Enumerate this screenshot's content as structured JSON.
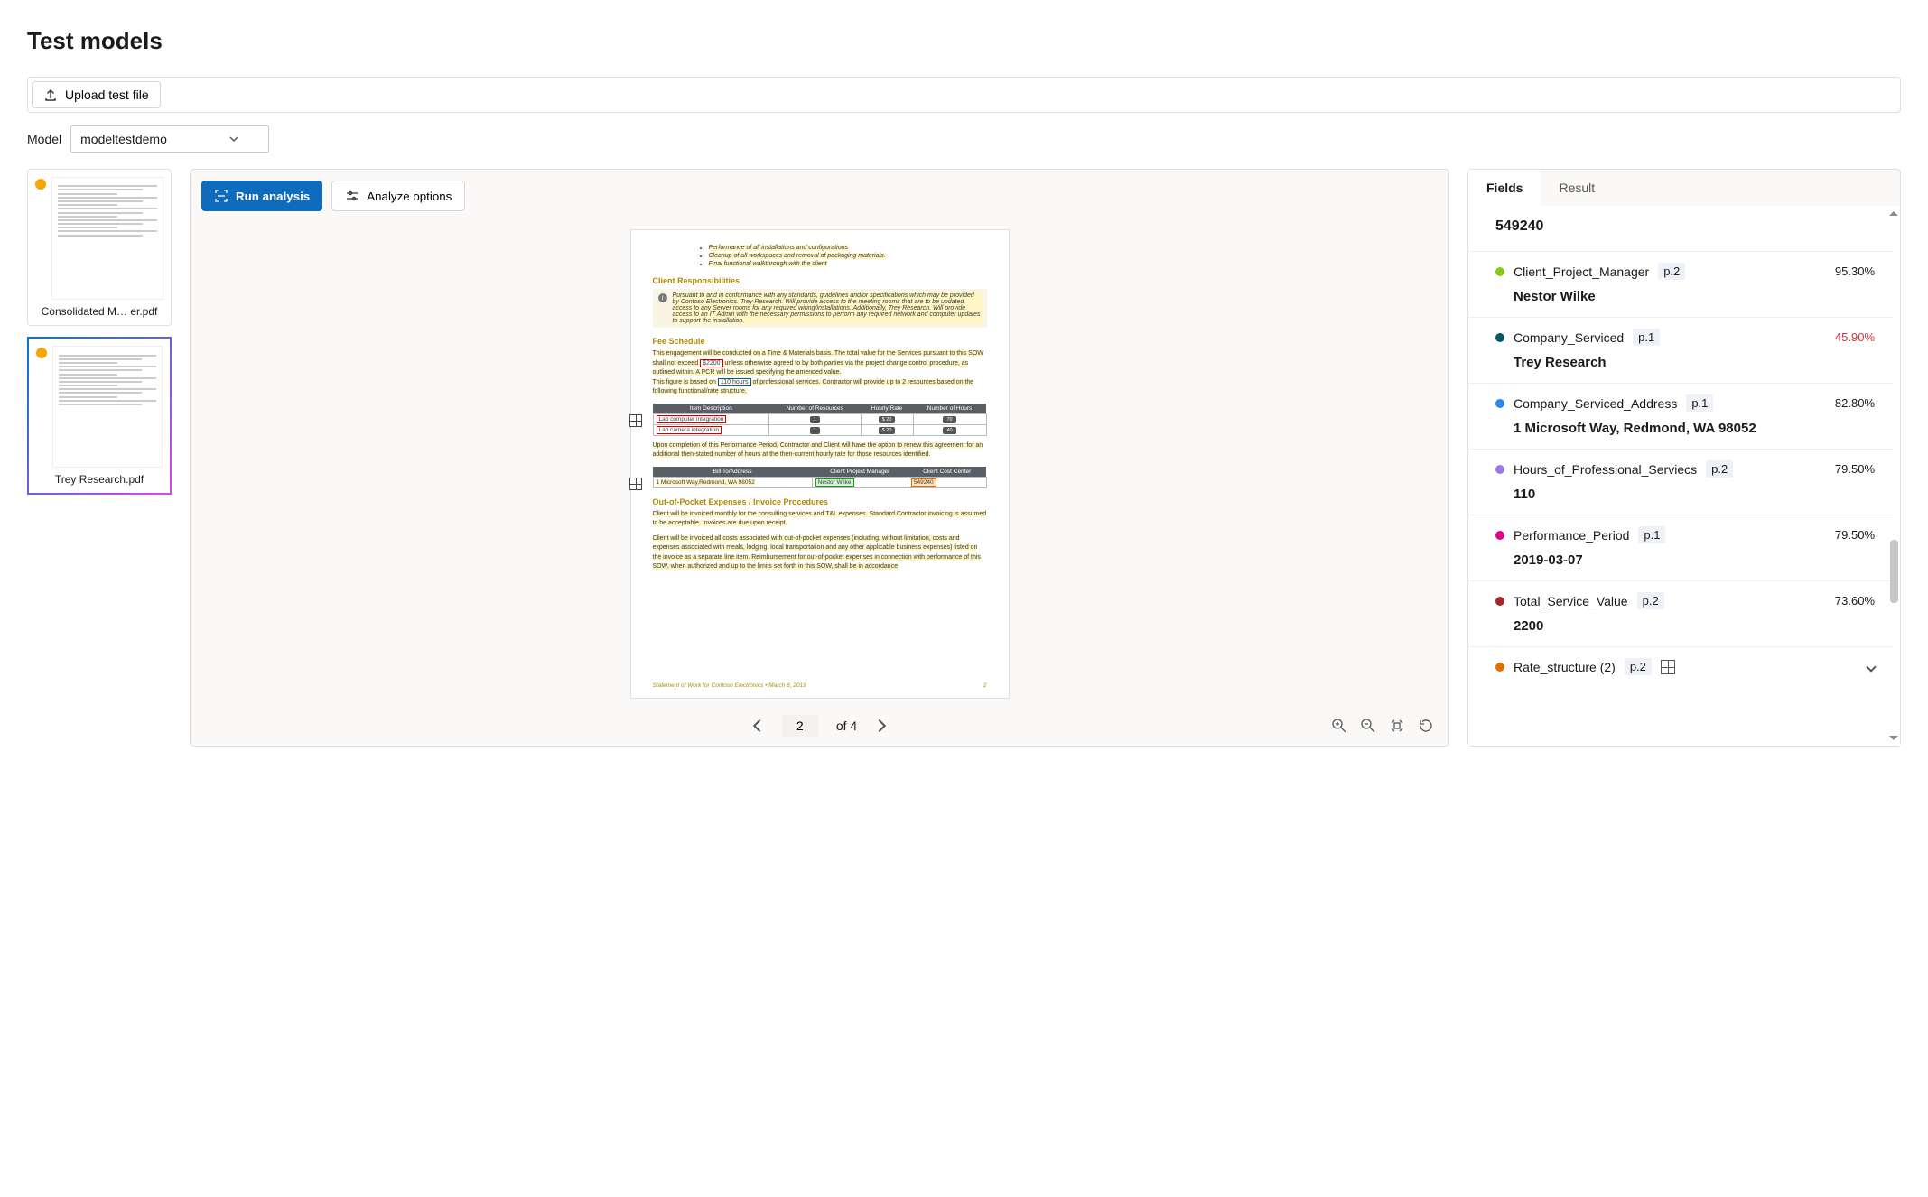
{
  "header": {
    "title": "Test models"
  },
  "toolbar": {
    "upload_label": "Upload test file"
  },
  "modelRow": {
    "label": "Model",
    "selected": "modeltestdemo"
  },
  "thumbs": [
    {
      "name": "Consolidated M… er.pdf",
      "selected": false
    },
    {
      "name": "Trey Research.pdf",
      "selected": true
    }
  ],
  "viewer": {
    "run_label": "Run analysis",
    "options_label": "Analyze options",
    "page_current": "2",
    "page_total": "of 4",
    "doc": {
      "bullets": [
        "Performance of all installations and configurations",
        "Cleanup of all workspaces and removal of packaging materials.",
        "Final functional walkthrough with the client"
      ],
      "client_resp_h": "Client Responsibilities",
      "client_resp_p": "Pursuant to and in conformance with any standards, guidelines and/or specifications which may be provided by Contoso Electronics. Trey Research. Will provide access to the meeting rooms that are to be updated, access to any Server rooms for any required wiring/installations. Additionally, Trey Research. Will provide access to an IT Admin with the necessary permissions to perform any required network and computer updates to support the installation.",
      "fee_h": "Fee Schedule",
      "fee_p1a": "This engagement will be conducted on a Time & Materials basis. The total value for the Services pursuant to this SOW shall not exceed ",
      "fee_val": "$2200",
      "fee_p1b": " unless otherwise agreed to by both parties via the project change control procedure, as outlined within. A PCR will be issued specifying the amended value.",
      "fee_p2a": "This figure is based on ",
      "fee_hours": "110 hours",
      "fee_p2b": " of professional services. Contractor will provide up to 2 resources based on the following functional/rate structure.",
      "fee_headers": [
        "Item Description",
        "Number of Resources",
        "Hourly Rate",
        "Number of Hours"
      ],
      "fee_rows": [
        {
          "desc": "Lab computer integration",
          "res": "1",
          "rate": "$ 20",
          "hrs": "70"
        },
        {
          "desc": "Lab camera integration",
          "res": "1",
          "rate": "$ 20",
          "hrs": "40"
        }
      ],
      "renew_p": "Upon completion of this Performance Period, Contractor and Client will have the option to renew this agreement for an additional then-stated number of hours at the then-current hourly rate for those resources identified.",
      "bill_headers": [
        "Bill To/Address",
        "Client Project Manager",
        "Client Cost Center"
      ],
      "bill_addr": "1 Microsoft Way,Redmond, WA 98052",
      "bill_pm": "Nestor Wilke",
      "bill_cost": "549240",
      "oop_h": "Out-of-Pocket Expenses / Invoice Procedures",
      "oop_p1": "Client will be invoiced monthly for the consulting services and T&L expenses. Standard Contractor invoicing is assumed to be acceptable. Invoices are due upon receipt.",
      "oop_p2": "Client will be invoiced all costs associated with out-of-pocket expenses (including, without limitation, costs and expenses associated with meals, lodging, local transportation and any other applicable business expenses) listed on the invoice as a separate line item. Reimbursement for out-of-pocket expenses in connection with performance of this SOW, when authorized and up to the limits set forth in this SOW, shall be in accordance",
      "footer_left": "Statement of Work for Contoso Electronics • March 6, 2019",
      "footer_right": "2"
    }
  },
  "results": {
    "top_value": "549240",
    "tabs": {
      "fields": "Fields",
      "result": "Result",
      "active": "fields"
    },
    "fields": [
      {
        "color": "#86c91e",
        "name": "Client_Project_Manager",
        "page": "p.2",
        "conf": "95.30%",
        "low": false,
        "value": "Nestor Wilke"
      },
      {
        "color": "#0b556a",
        "name": "Company_Serviced",
        "page": "p.1",
        "conf": "45.90%",
        "low": true,
        "value": "Trey Research"
      },
      {
        "color": "#2a88e6",
        "name": "Company_Serviced_Address",
        "page": "p.1",
        "conf": "82.80%",
        "low": false,
        "value": "1 Microsoft Way, Redmond, WA 98052"
      },
      {
        "color": "#a079e8",
        "name": "Hours_of_Professional_Serviecs",
        "page": "p.2",
        "conf": "79.50%",
        "low": false,
        "value": "110"
      },
      {
        "color": "#e3008c",
        "name": "Performance_Period",
        "page": "p.1",
        "conf": "79.50%",
        "low": false,
        "value": "2019-03-07"
      },
      {
        "color": "#a4262c",
        "name": "Total_Service_Value",
        "page": "p.2",
        "conf": "73.60%",
        "low": false,
        "value": "2200"
      },
      {
        "color": "#e07000",
        "name": "Rate_structure (2)",
        "page": "p.2",
        "conf": "",
        "low": false,
        "value": "",
        "hasTable": true,
        "expandable": true
      }
    ]
  }
}
